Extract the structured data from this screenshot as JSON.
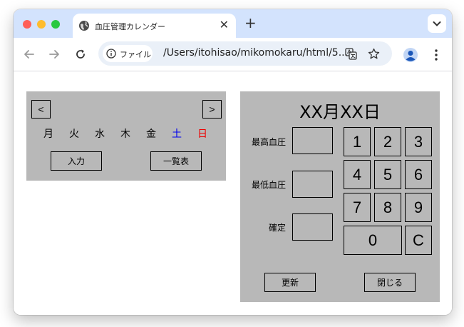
{
  "browser": {
    "tab_title": "血圧管理カレンダー",
    "close_glyph": "✕",
    "new_tab_glyph": "+",
    "omnibox_chip": "ファイル",
    "url": "/Users/itohisao/mikomokaru/html/5..."
  },
  "calendar": {
    "prev_label": "<",
    "next_label": ">",
    "weekdays": [
      "月",
      "火",
      "水",
      "木",
      "金",
      "土",
      "日"
    ],
    "weekday_colors": {
      "saturday": "#0000ee",
      "sunday": "#ee0000"
    },
    "input_label": "入力",
    "list_label": "一覧表"
  },
  "entry": {
    "date_title": "XX月XX日",
    "labels": {
      "systolic": "最高血圧",
      "diastolic": "最低血圧",
      "confirm": "確定"
    },
    "keys": [
      "1",
      "2",
      "3",
      "4",
      "5",
      "6",
      "7",
      "8",
      "9",
      "0",
      "C"
    ],
    "update_label": "更新",
    "close_label": "閉じる"
  }
}
